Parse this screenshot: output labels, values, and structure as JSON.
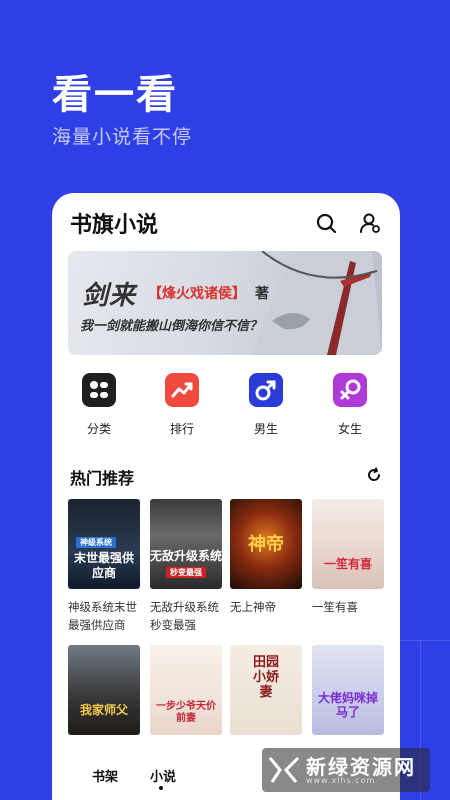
{
  "hero": {
    "title": "看一看",
    "subtitle": "海量小说看不停"
  },
  "app": {
    "title": "书旗小说",
    "header_icons": [
      "search-icon",
      "user-settings-icon"
    ]
  },
  "banner": {
    "title": "剑来",
    "book": "【烽火戏诸侯】",
    "author_suffix": "著",
    "tagline": "我一剑就能搬山倒海你信不信？"
  },
  "categories": [
    {
      "label": "分类",
      "icon": "category-icon",
      "color": "#1f1f1f"
    },
    {
      "label": "排行",
      "icon": "trending-icon",
      "color": "#f04a3e"
    },
    {
      "label": "男生",
      "icon": "male-icon",
      "color": "#2b3bd6"
    },
    {
      "label": "女生",
      "icon": "female-icon",
      "color": "#b03ad8"
    }
  ],
  "hot": {
    "title": "热门推荐",
    "refresh_icon": "refresh-icon"
  },
  "books": [
    {
      "name": "神级系统末世最强供应商",
      "cover_title": "末世最强供应商",
      "cover_tag": "神级系统"
    },
    {
      "name": "无敌升级系统秒变最强",
      "cover_title": "无敌升级系统",
      "cover_tag": "秒变最强"
    },
    {
      "name": "无上神帝",
      "cover_title": "神帝",
      "cover_tag": ""
    },
    {
      "name": "一笙有喜",
      "cover_title": "一笙有喜",
      "cover_tag": ""
    },
    {
      "name": "",
      "cover_title": "我家师父",
      "cover_tag": ""
    },
    {
      "name": "",
      "cover_title": "一步少爷天价前妻",
      "cover_tag": ""
    },
    {
      "name": "",
      "cover_title": "田园小娇妻",
      "cover_tag": ""
    },
    {
      "name": "",
      "cover_title": "大佬妈咪掉马了",
      "cover_tag": ""
    }
  ],
  "nav": {
    "shelf": "书架",
    "novel": "小说"
  },
  "watermark": {
    "text": "新绿资源网",
    "url": "www.xlhs.com"
  }
}
